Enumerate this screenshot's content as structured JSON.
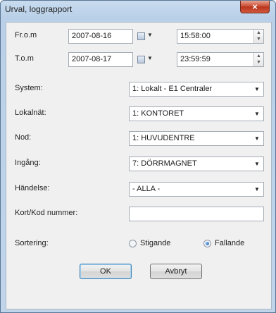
{
  "window": {
    "title": "Urval, loggrapport",
    "close_icon": "×"
  },
  "fields": {
    "from_label": "Fr.o.m",
    "from_date": "2007-08-16",
    "from_time": "15:58:00",
    "to_label": "T.o.m",
    "to_date": "2007-08-17",
    "to_time": "23:59:59"
  },
  "selects": [
    {
      "label": "System:",
      "value": "1: Lokalt - E1 Centraler"
    },
    {
      "label": "Lokalnät:",
      "value": "1: KONTORET"
    },
    {
      "label": "Nod:",
      "value": "1: HUVUDENTRE"
    },
    {
      "label": "Ingång:",
      "value": "7: DÖRRMAGNET"
    },
    {
      "label": "Händelse:",
      "value": "- ALLA -"
    }
  ],
  "card": {
    "label": "Kort/Kod nummer:",
    "value": ""
  },
  "sort": {
    "label": "Sortering:",
    "ascending": "Stigande",
    "descending": "Fallande",
    "selected": "Fallande"
  },
  "buttons": {
    "ok": "OK",
    "cancel": "Avbryt"
  },
  "icons": {
    "calendar": "calendar-icon",
    "dropdown": "chevron-down-icon",
    "spinner": "spinner-arrows-icon"
  },
  "colors": {
    "titlebar": "#c0d5ea",
    "close": "#c7462c",
    "default_button": "#3c7fb1"
  }
}
